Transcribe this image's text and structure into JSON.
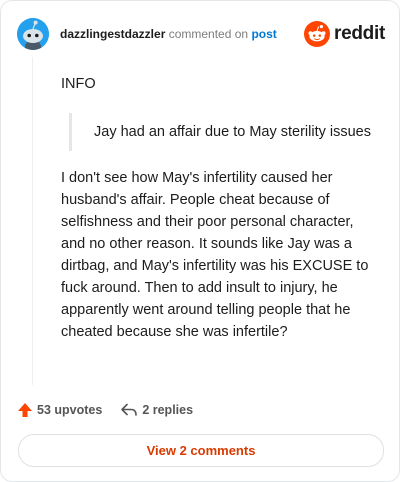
{
  "header": {
    "username": "dazzlingestdazzler",
    "action_text": "commented on",
    "post_link": "post",
    "logo_text": "reddit"
  },
  "comment": {
    "paragraph_1": "INFO",
    "quote": "Jay had an affair due to May sterility issues",
    "paragraph_2": "I don't see how May's infertility caused her husband's affair. People cheat because of selfishness and their poor personal character, and no other reason. It sounds like Jay was a dirtbag, and May's infertility was his EXCUSE to fuck around. Then to add insult to injury, he apparently went around telling people that he cheated because she was infertile?"
  },
  "footer": {
    "upvotes_label": "53 upvotes",
    "replies_label": "2 replies"
  },
  "view_button_label": "View 2 comments",
  "colors": {
    "brand_orange": "#ff4500",
    "link_blue": "#0079d3",
    "button_text": "#d93a00"
  },
  "icons": [
    "snoo-avatar-icon",
    "reddit-logo-icon",
    "upvote-arrow-icon",
    "reply-arrow-icon"
  ]
}
